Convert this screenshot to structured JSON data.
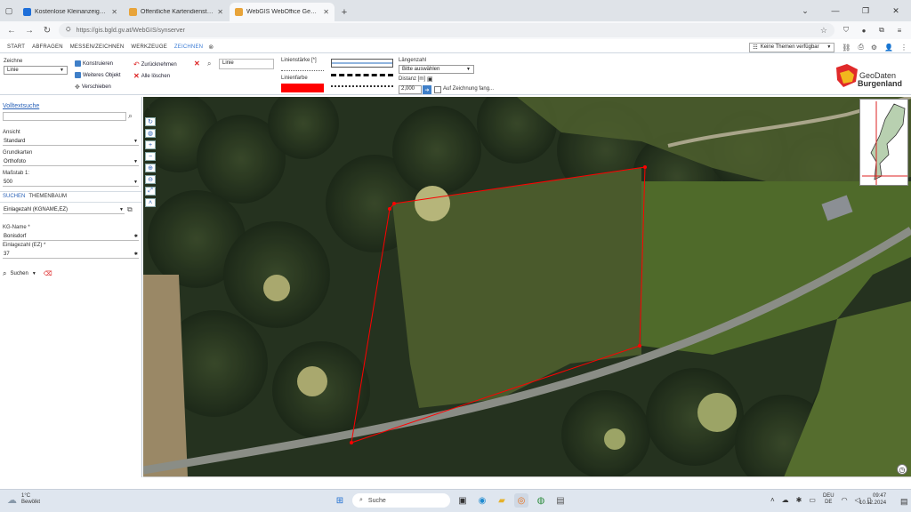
{
  "browser": {
    "tabs": [
      {
        "label": "Kostenlose Kleinanzeigen, Imm",
        "color": "#1e6fd9",
        "active": false
      },
      {
        "label": "Öffentliche Kartendienste - Ge",
        "color": "#e8a43a",
        "active": false
      },
      {
        "label": "WebGIS WebOffice GeoDATEN",
        "color": "#e8a43a",
        "active": true
      }
    ],
    "tab_close": "✕",
    "new_tab": "+",
    "url": "https://gis.bgld.gv.at/WebGIS/synserver"
  },
  "app_menu": {
    "items": [
      "START",
      "ABFRAGEN",
      "MESSEN/ZEICHNEN",
      "WERKZEUGE",
      "ZEICHNEN"
    ],
    "active_index": 4,
    "dataset_select": "Keine Themen verfügbar"
  },
  "ribbon": {
    "zeichne_label": "Zeichne",
    "zeichne_value": "Linie",
    "konstruieren": "Konstruieren",
    "weiteres_objekt": "Weiteres Objekt",
    "verschieben": "Verschieben",
    "zuruecknehmen": "Zurücknehmen",
    "alle_loeschen": "Alle löschen",
    "style_input": "Linie",
    "linienstaerke_label": "Linienstärke [*]",
    "linienfarbe_label": "Linienfarbe",
    "line_color": "#ff0000",
    "laengenzahl_label": "Längenzahl",
    "laengenzahl_value": "Bitte auswählen",
    "distanz_label": "Distanz [m]",
    "distanz_value": "2,000",
    "auf_zeichnung_label": "Auf Zeichnung fang..."
  },
  "logo": {
    "line1": "GeoDaten",
    "line2": "Burgenland"
  },
  "left_panel": {
    "volltextsuche": "Volltextsuche",
    "ansicht_label": "Ansicht",
    "ansicht_value": "Standard",
    "grundkarten_label": "Grundkarten",
    "grundkarten_value": "Orthofoto",
    "massstab_label": "Maßstab 1:",
    "massstab_value": "500",
    "tab_suchen": "SUCHEN",
    "tab_themenbaum": "THEMENBAUM",
    "search_type": "Einlagezahl (KGNAME,EZ)",
    "kg_name_label": "KG-Name *",
    "kg_name_value": "Bonisdorf",
    "einlagezahl_label": "Einlagezahl (EZ) *",
    "einlagezahl_value": "37",
    "suchen_button": "Suchen"
  },
  "taskbar": {
    "weather_temp": "1°C",
    "weather_desc": "Bewölkt",
    "search_placeholder": "Suche",
    "lang_top": "DEU",
    "lang_bottom": "DE",
    "time": "09:47",
    "date": "10.12.2024"
  }
}
